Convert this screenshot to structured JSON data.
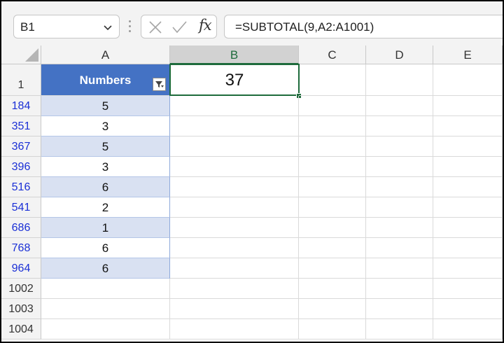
{
  "name_box": {
    "value": "B1",
    "dropdown_icon": "chevron-down-icon"
  },
  "formula_bar": {
    "cancel_icon": "x-icon",
    "enter_icon": "checkmark-icon",
    "fx_label": "fx",
    "formula": "=SUBTOTAL(9,A2:A1001)"
  },
  "columns": [
    "A",
    "B",
    "C",
    "D",
    "E"
  ],
  "selected_column": "B",
  "header_row": {
    "row_number": "1",
    "a1": "Numbers",
    "filter_icon": "filter-dropdown-icon",
    "b1": "37"
  },
  "rows": [
    {
      "row": "184",
      "value": "5"
    },
    {
      "row": "351",
      "value": "3"
    },
    {
      "row": "367",
      "value": "5"
    },
    {
      "row": "396",
      "value": "3"
    },
    {
      "row": "516",
      "value": "6"
    },
    {
      "row": "541",
      "value": "2"
    },
    {
      "row": "686",
      "value": "1"
    },
    {
      "row": "768",
      "value": "6"
    },
    {
      "row": "964",
      "value": "6"
    },
    {
      "row": "1002",
      "value": ""
    },
    {
      "row": "1003",
      "value": ""
    },
    {
      "row": "1004",
      "value": ""
    }
  ],
  "colors": {
    "table_header": "#4472c4",
    "band_row": "#d9e1f2",
    "filtered_row_number": "#1a2fd6",
    "selection": "#1e6b3c"
  }
}
